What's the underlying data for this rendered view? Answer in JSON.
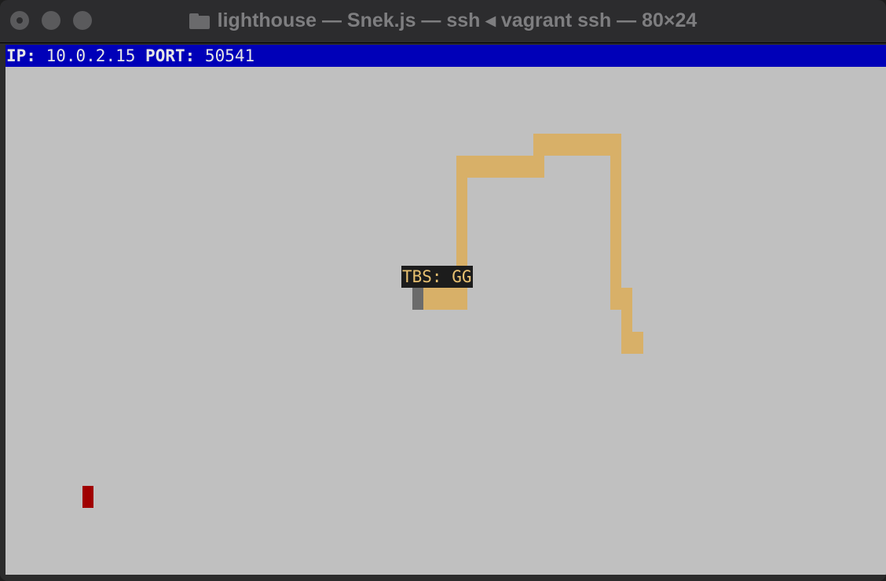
{
  "window": {
    "title": "lighthouse — Snek.js — ssh ◂ vagrant ssh — 80×24",
    "controls": [
      "close",
      "minimize",
      "zoom"
    ],
    "title_icon": "folder-icon"
  },
  "terminal": {
    "status": {
      "ip_label": "IP:",
      "ip_value": "10.0.2.15",
      "port_label": "PORT:",
      "port_value": "50541"
    },
    "background_color": "#c0c0c0",
    "status_bar_color": "#0000b8",
    "game": {
      "snake_color": "#d8b068",
      "snake_head_color": "#6b6b6b",
      "food_color": "#a00000",
      "player_tag": "TBS: GG"
    }
  }
}
